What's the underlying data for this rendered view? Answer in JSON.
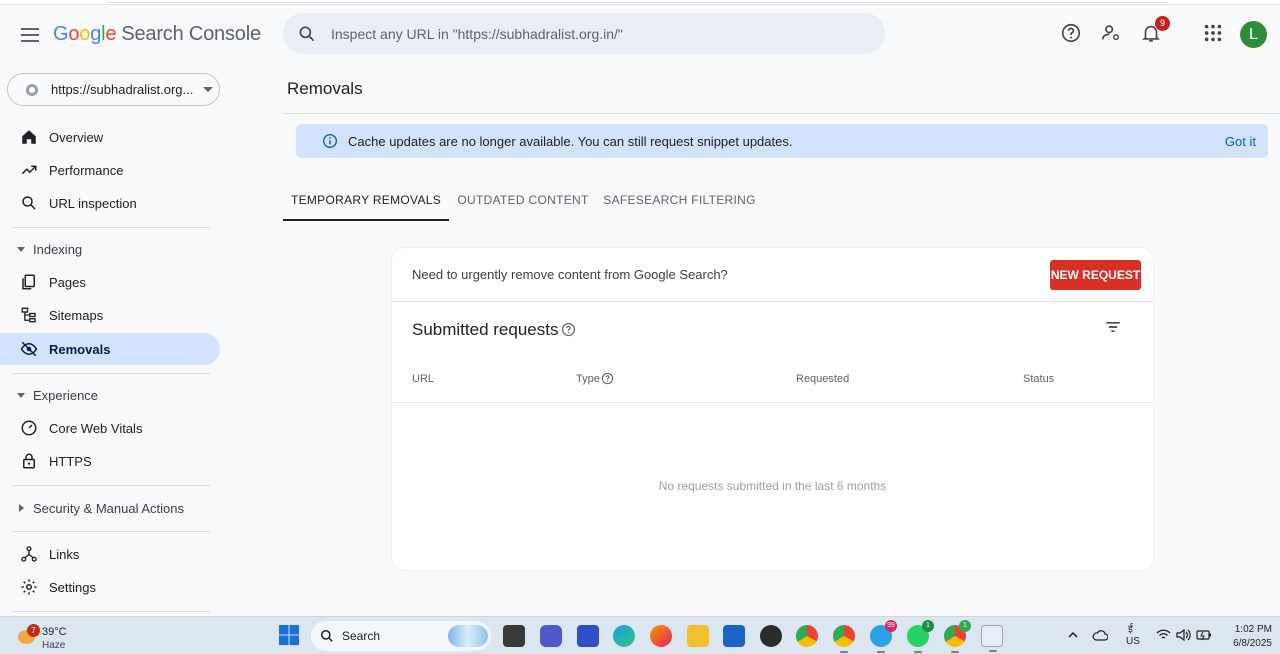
{
  "header": {
    "logo_letters": [
      "G",
      "o",
      "o",
      "g",
      "l",
      "e"
    ],
    "product": "Search Console",
    "search_placeholder": "Inspect any URL in \"https://subhadralist.org.in/\"",
    "notification_count": "9",
    "avatar_letter": "L"
  },
  "sidebar": {
    "property": "https://subhadralist.org...",
    "items": [
      {
        "label": "Overview",
        "icon": "home-icon"
      },
      {
        "label": "Performance",
        "icon": "trending-up-icon"
      },
      {
        "label": "URL inspection",
        "icon": "search-icon"
      },
      {
        "label": "Pages",
        "icon": "pages-icon"
      },
      {
        "label": "Sitemaps",
        "icon": "sitemap-icon"
      },
      {
        "label": "Removals",
        "icon": "eye-off-icon",
        "active": true
      },
      {
        "label": "Core Web Vitals",
        "icon": "gauge-icon"
      },
      {
        "label": "HTTPS",
        "icon": "lock-icon"
      },
      {
        "label": "Links",
        "icon": "links-icon"
      },
      {
        "label": "Settings",
        "icon": "gear-icon"
      }
    ],
    "sections": {
      "indexing": "Indexing",
      "experience": "Experience",
      "security": "Security & Manual Actions"
    }
  },
  "main": {
    "title": "Removals",
    "banner_text": "Cache updates are no longer available. You can still request snippet updates.",
    "banner_button": "Got it",
    "tabs": [
      "TEMPORARY REMOVALS",
      "OUTDATED CONTENT",
      "SAFESEARCH FILTERING"
    ],
    "card": {
      "urgent_text": "Need to urgently remove content from Google Search?",
      "new_request": "NEW REQUEST",
      "submitted_title": "Submitted requests",
      "columns": [
        "URL",
        "Type",
        "Requested",
        "Status"
      ],
      "empty_text": "No requests submitted in the last 6 months"
    }
  },
  "taskbar": {
    "weather_badge": "7",
    "temperature": "39°C",
    "condition": "Haze",
    "search_label": "Search",
    "chrome_badge": "",
    "telegram_badge": "99",
    "whatsapp_badge": "1",
    "chrome2_badge": "1",
    "lang_top": "ई",
    "lang_bottom": "US",
    "time": "1:02 PM",
    "date": "6/8/2025"
  },
  "colors": {
    "accent": "#0b57d0",
    "active_nav": "#d3e3fd",
    "new_request": "#d93025",
    "avatar": "#2e8b3a"
  }
}
